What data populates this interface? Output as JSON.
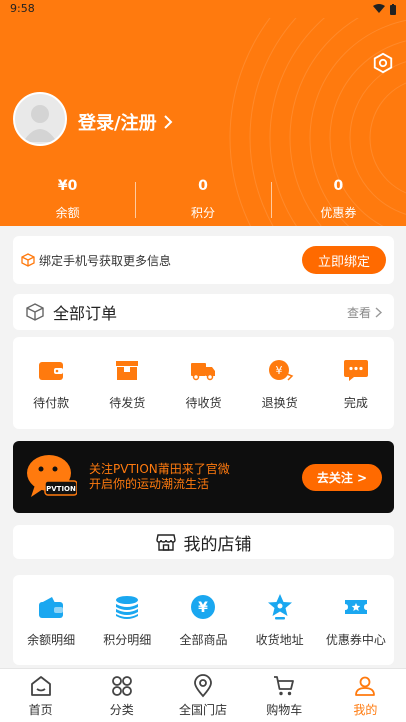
{
  "status_bar": {
    "time": "9:58"
  },
  "profile": {
    "login_label": "登录/注册"
  },
  "stats": [
    {
      "value": "¥0",
      "label": "余额"
    },
    {
      "value": "0",
      "label": "积分"
    },
    {
      "value": "0",
      "label": "优惠券"
    }
  ],
  "bind_phone": {
    "message": "绑定手机号获取更多信息",
    "button": "立即绑定"
  },
  "orders": {
    "title": "全部订单",
    "view_more": "查看",
    "items": [
      {
        "label": "待付款",
        "icon": "wallet-icon"
      },
      {
        "label": "待发货",
        "icon": "box-icon"
      },
      {
        "label": "待收货",
        "icon": "truck-icon"
      },
      {
        "label": "退换货",
        "icon": "refund-icon"
      },
      {
        "label": "完成",
        "icon": "chat-bubble-icon"
      }
    ]
  },
  "banner": {
    "logo_text": "PVTION",
    "line1": "关注PVTION莆田来了官微",
    "line2": "开启你的运动潮流生活",
    "button": "去关注 >"
  },
  "shop": {
    "title": "我的店铺"
  },
  "tools": [
    {
      "label": "余额明细",
      "icon": "wallet-icon"
    },
    {
      "label": "积分明细",
      "icon": "coins-icon"
    },
    {
      "label": "全部商品",
      "icon": "yen-circle-icon"
    },
    {
      "label": "收货地址",
      "icon": "location-star-icon"
    },
    {
      "label": "优惠券中心",
      "icon": "ticket-icon"
    }
  ],
  "tabbar": [
    {
      "label": "首页",
      "icon": "home-icon"
    },
    {
      "label": "分类",
      "icon": "grid-icon"
    },
    {
      "label": "全国门店",
      "icon": "location-pin-icon"
    },
    {
      "label": "购物车",
      "icon": "cart-icon"
    },
    {
      "label": "我的",
      "icon": "user-icon",
      "active": true
    }
  ],
  "colors": {
    "brand_orange": "#ff7a0e",
    "tool_blue": "#1aa7f0",
    "banner_bg": "#0e0e0e"
  }
}
